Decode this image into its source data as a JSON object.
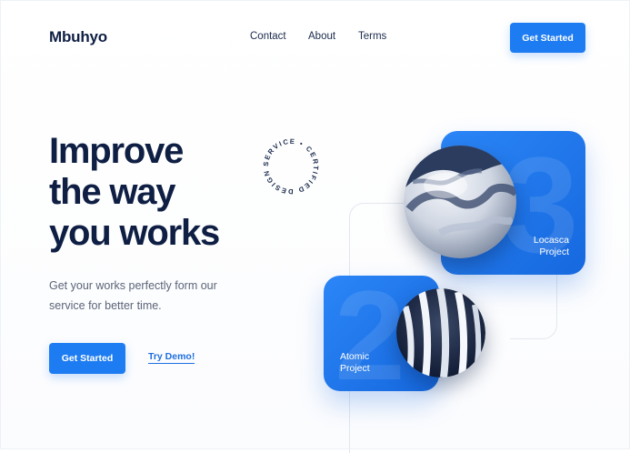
{
  "header": {
    "logo": "Mbuhyo",
    "nav": [
      "Contact",
      "About",
      "Terms"
    ],
    "cta_label": "Get Started"
  },
  "hero": {
    "title_lines": [
      "Improve",
      "the way",
      "you works"
    ],
    "subtitle": "Get your works perfectly form our service for better time.",
    "primary_label": "Get Started",
    "secondary_label": "Try Demo!"
  },
  "badge": {
    "text": "SERVICE • CERTIFIED DESIGNS •"
  },
  "cards": [
    {
      "number": "3",
      "line1": "Locasca",
      "line2": "Project"
    },
    {
      "number": "2",
      "line1": "Atomic",
      "line2": "Project"
    }
  ],
  "colors": {
    "accent": "#1e7cf2",
    "heading": "#0f1f44",
    "body_text": "#5b6478"
  }
}
